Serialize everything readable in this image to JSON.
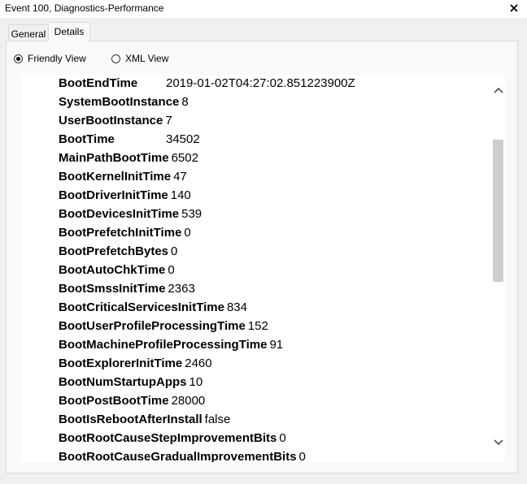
{
  "window": {
    "title": "Event 100, Diagnostics-Performance"
  },
  "tabs": [
    {
      "label": "General"
    },
    {
      "label": "Details"
    }
  ],
  "view_options": {
    "friendly_label": "Friendly View",
    "xml_label": "XML View",
    "selected": "Friendly View"
  },
  "rows": [
    {
      "key": "BootEndTime",
      "value": "2019-01-02T04:27:02.851223900Z"
    },
    {
      "key": "SystemBootInstance",
      "value": "8"
    },
    {
      "key": "UserBootInstance",
      "value": "7"
    },
    {
      "key": "BootTime",
      "value": "34502"
    },
    {
      "key": "MainPathBootTime",
      "value": "6502"
    },
    {
      "key": "BootKernelInitTime",
      "value": "47"
    },
    {
      "key": "BootDriverInitTime",
      "value": "140"
    },
    {
      "key": "BootDevicesInitTime",
      "value": "539"
    },
    {
      "key": "BootPrefetchInitTime",
      "value": "0"
    },
    {
      "key": "BootPrefetchBytes",
      "value": "0"
    },
    {
      "key": "BootAutoChkTime",
      "value": "0"
    },
    {
      "key": "BootSmssInitTime",
      "value": "2363"
    },
    {
      "key": "BootCriticalServicesInitTime",
      "value": "834"
    },
    {
      "key": "BootUserProfileProcessingTime",
      "value": "152"
    },
    {
      "key": "BootMachineProfileProcessingTime",
      "value": "91"
    },
    {
      "key": "BootExplorerInitTime",
      "value": "2460"
    },
    {
      "key": "BootNumStartupApps",
      "value": "10"
    },
    {
      "key": "BootPostBootTime",
      "value": "28000"
    },
    {
      "key": "BootIsRebootAfterInstall",
      "value": "false"
    },
    {
      "key": "BootRootCauseStepImprovementBits",
      "value": "0"
    },
    {
      "key": "BootRootCauseGradualImprovementBits",
      "value": "0"
    }
  ]
}
